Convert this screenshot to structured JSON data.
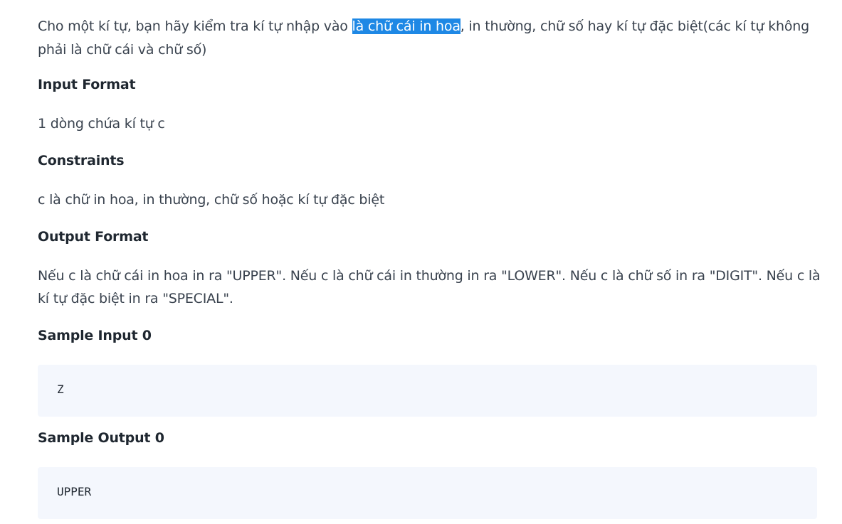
{
  "problem": {
    "description_before": "Cho một kí tự, bạn hãy kiểm tra kí tự nhập vào ",
    "description_highlight": "là chữ cái in hoa",
    "description_after": ", in thường, chữ số hay kí tự đặc biệt(các kí tự không phải là chữ cái và chữ số)"
  },
  "input_format": {
    "heading": "Input Format",
    "text": "1 dòng chứa kí tự c"
  },
  "constraints": {
    "heading": "Constraints",
    "text": "c là chữ in hoa, in thường, chữ số hoặc kí tự đặc biệt"
  },
  "output_format": {
    "heading": "Output Format",
    "text": "Nếu c là chữ cái in hoa in ra \"UPPER\". Nếu c là chữ cái in thường in ra \"LOWER\". Nếu c là chữ số in ra \"DIGIT\". Nếu c là kí tự đặc biệt in ra \"SPECIAL\"."
  },
  "sample_input": {
    "heading": "Sample Input 0",
    "value": "Z"
  },
  "sample_output": {
    "heading": "Sample Output 0",
    "value": "UPPER"
  }
}
